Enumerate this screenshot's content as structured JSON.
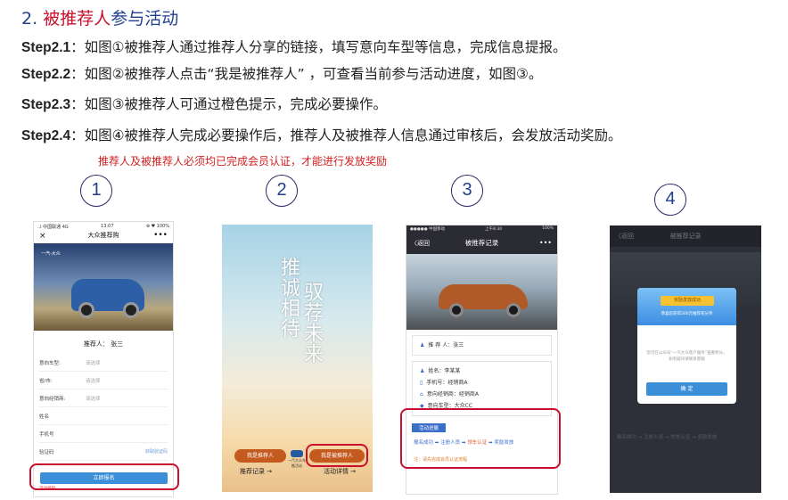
{
  "header": {
    "number": "2.",
    "title_red": "被推荐人",
    "title_rest": "参与活动"
  },
  "steps": [
    {
      "label": "Step2.1",
      "text": "：如图①被推荐人通过推荐人分享的链接，填写意向车型等信息，完成信息提报。"
    },
    {
      "label": "Step2.2",
      "text": "：如图②被推荐人点击“我是被推荐人” ，可查看当前参与活动进度，如图③。"
    },
    {
      "label": "Step2.3",
      "text": "：如图③被推荐人可通过橙色提示，完成必要操作。"
    },
    {
      "label": "Step2.4",
      "text": "：如图④被推荐人完成必要操作后，推荐人及被推荐人信息通过审核后，会发放活动奖励。"
    }
  ],
  "note": "推荐人及被推荐人必须均已完成会员认证，才能进行发放奖励",
  "markers": [
    "1",
    "2",
    "3",
    "4"
  ],
  "phone1": {
    "status_left": "..l 中国联通 4G",
    "status_time": "13:07",
    "status_right": "⊕ ♥ 100%",
    "title": "大众推荐购",
    "close": "×",
    "more": "•••",
    "brand": "一汽-大众",
    "referrer": "推荐人：  张三",
    "fields": [
      {
        "label": "意向车型:",
        "placeholder": "请选择"
      },
      {
        "label": "省/市:",
        "placeholder": "请选择"
      },
      {
        "label": "意向经销商:",
        "placeholder": "请选择"
      },
      {
        "label": "姓名",
        "placeholder": ""
      },
      {
        "label": "手机号",
        "placeholder": ""
      },
      {
        "label": "验证码",
        "placeholder": ""
      }
    ],
    "get_code": "获取验证码",
    "submit": "立即报名",
    "rules": "活动规则"
  },
  "phone2": {
    "col1": "推诚相待",
    "col2": "驭荐未来",
    "btn_referrer": "我是推荐人",
    "btn_referee": "我是被推荐人",
    "link_records": "推荐记录 →",
    "link_details": "活动详情 →",
    "center_caption": "一汽大众车推活动"
  },
  "phone3": {
    "status_left": "●●●●● 中国移动",
    "status_time": "上午8:30",
    "status_right": "100%",
    "back": "〈返回",
    "title": "被推荐记录",
    "more": "•••",
    "referrer": "推 荐 人：张三",
    "items": [
      {
        "icon": "♟",
        "text": "姓名：李某某"
      },
      {
        "icon": "▯",
        "text": "手机号：经销商A"
      },
      {
        "icon": "⌂",
        "text": "意向经销商：经销商A"
      },
      {
        "icon": "◆",
        "text": "意向车型：大众CC"
      }
    ],
    "progress_tag": "活动进展",
    "progress_steps": [
      "报名成功",
      "注册人员",
      "领车认证",
      "奖励发放"
    ],
    "warning": "注：请先完成会员认证流程"
  },
  "phone4": {
    "back": "〈返回",
    "title": "被推荐记录",
    "modal_badge": "奖励发放成功",
    "modal_sub": "恭喜您获得300元推荐积分奖",
    "modal_text": "您可在公众号“一汽大众客户服务”查看积分，如有疑问请联系客服",
    "modal_button": "确 定",
    "bg_progress": "报名成功 → 注册人员 → 领车认证 → 奖励发放"
  }
}
